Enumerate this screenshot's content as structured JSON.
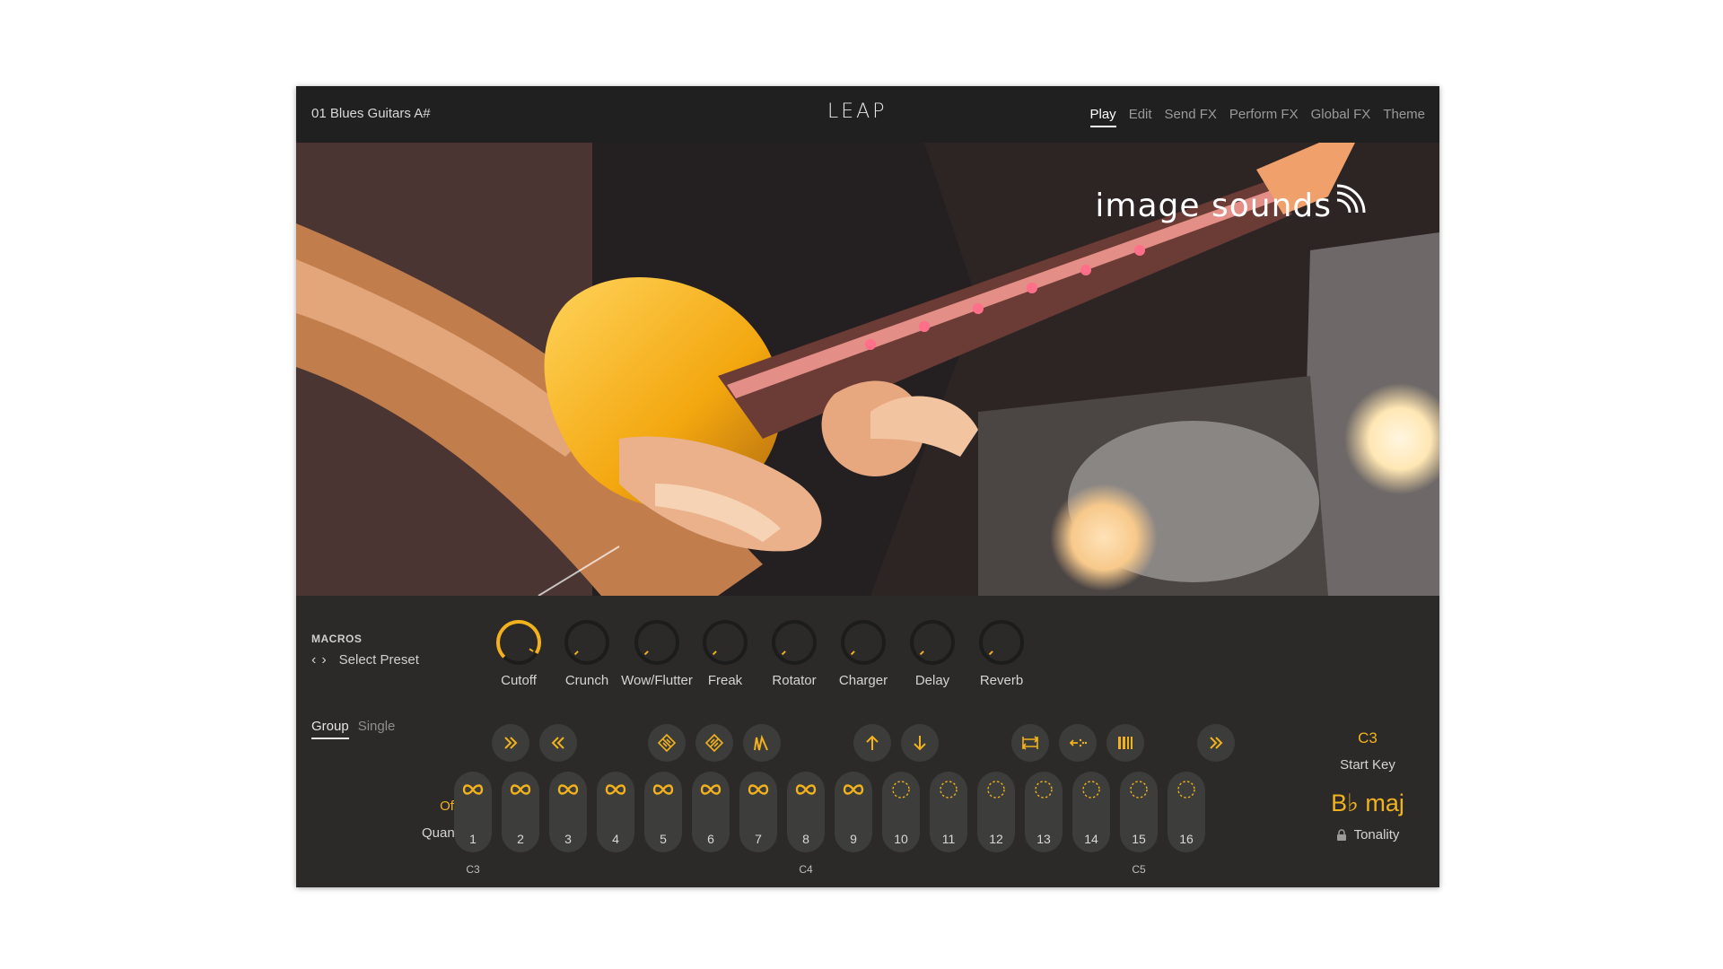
{
  "header": {
    "preset_name": "01 Blues Guitars A#",
    "logo": "LEAP",
    "tabs": [
      {
        "label": "Play",
        "active": true
      },
      {
        "label": "Edit",
        "active": false
      },
      {
        "label": "Send FX",
        "active": false
      },
      {
        "label": "Perform FX",
        "active": false
      },
      {
        "label": "Global FX",
        "active": false
      },
      {
        "label": "Theme",
        "active": false
      }
    ]
  },
  "artwork": {
    "brand": "image sounds"
  },
  "macros": {
    "title": "MACROS",
    "select_preset": "Select Preset",
    "knobs": [
      {
        "label": "Cutoff",
        "value": 0.95
      },
      {
        "label": "Crunch",
        "value": 0.0
      },
      {
        "label": "Wow/Flutter",
        "value": 0.0
      },
      {
        "label": "Freak",
        "value": 0.0
      },
      {
        "label": "Rotator",
        "value": 0.0
      },
      {
        "label": "Charger",
        "value": 0.0
      },
      {
        "label": "Delay",
        "value": 0.0
      },
      {
        "label": "Reverb",
        "value": 0.0
      }
    ]
  },
  "mode_tabs": [
    {
      "label": "Group",
      "active": true
    },
    {
      "label": "Single",
      "active": false
    }
  ],
  "quantize": {
    "value": "Off",
    "label": "Quantize"
  },
  "actions": [
    "fast-forward-icon",
    "rewind-icon",
    "reverse-diamond-icon",
    "forward-diamond-icon",
    "envelope-icon",
    "pitch-up-icon",
    "pitch-down-icon",
    "swap-icon",
    "stretch-icon",
    "slice-icon",
    "skip-icon"
  ],
  "keys": [
    {
      "num": "1",
      "loop": true
    },
    {
      "num": "2",
      "loop": true
    },
    {
      "num": "3",
      "loop": true
    },
    {
      "num": "4",
      "loop": true
    },
    {
      "num": "5",
      "loop": true
    },
    {
      "num": "6",
      "loop": true
    },
    {
      "num": "7",
      "loop": true
    },
    {
      "num": "8",
      "loop": true
    },
    {
      "num": "9",
      "loop": true
    },
    {
      "num": "10",
      "loop": false
    },
    {
      "num": "11",
      "loop": false
    },
    {
      "num": "12",
      "loop": false
    },
    {
      "num": "13",
      "loop": false
    },
    {
      "num": "14",
      "loop": false
    },
    {
      "num": "15",
      "loop": false
    },
    {
      "num": "16",
      "loop": false
    }
  ],
  "octaves": [
    "C3",
    "C4",
    "C5"
  ],
  "start_key": {
    "value": "C3",
    "label": "Start Key"
  },
  "tonality": {
    "value": "B♭ maj",
    "label": "Tonality"
  },
  "colors": {
    "accent": "#f1b21d",
    "panel": "#2b2a29",
    "header": "#202020"
  }
}
